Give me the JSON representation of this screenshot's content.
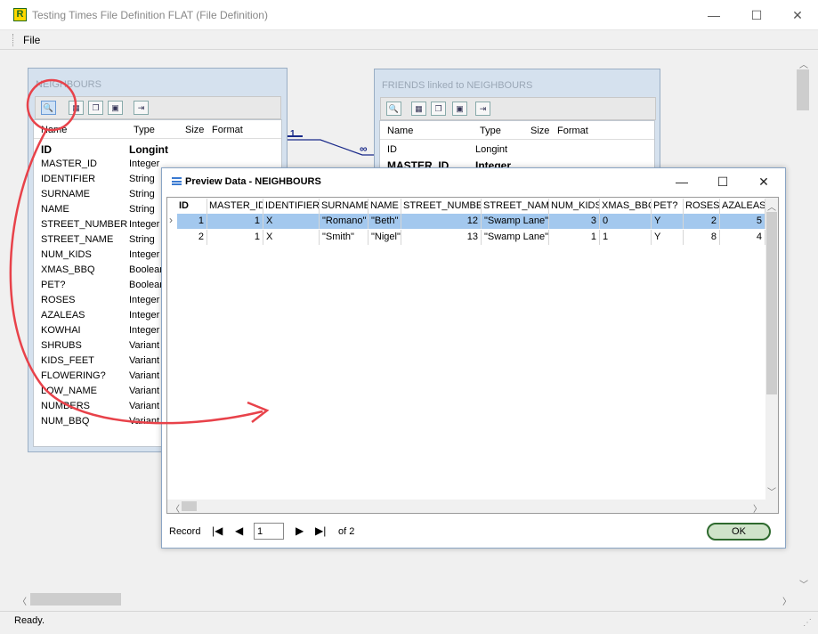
{
  "window": {
    "title": "Testing Times File Definition FLAT (File Definition)",
    "app_icon_letter": "R",
    "minimize_glyph": "—",
    "maximize_glyph": "☐",
    "close_glyph": "✕"
  },
  "menu": {
    "file": "File"
  },
  "status": "Ready.",
  "neighbours": {
    "title": "NEIGHBOURS",
    "columns": [
      "Name",
      "Type",
      "Size",
      "Format"
    ],
    "fields": [
      {
        "name": "ID",
        "type": "Longint",
        "bold": true
      },
      {
        "name": "MASTER_ID",
        "type": "Integer"
      },
      {
        "name": "IDENTIFIER",
        "type": "String"
      },
      {
        "name": "SURNAME",
        "type": "String"
      },
      {
        "name": "NAME",
        "type": "String"
      },
      {
        "name": "STREET_NUMBER",
        "type": "Integer"
      },
      {
        "name": "STREET_NAME",
        "type": "String"
      },
      {
        "name": "NUM_KIDS",
        "type": "Integer"
      },
      {
        "name": "XMAS_BBQ",
        "type": "Boolean"
      },
      {
        "name": "PET?",
        "type": "Boolean"
      },
      {
        "name": "ROSES",
        "type": "Integer"
      },
      {
        "name": "AZALEAS",
        "type": "Integer"
      },
      {
        "name": "KOWHAI",
        "type": "Integer"
      },
      {
        "name": "SHRUBS",
        "type": "Variant"
      },
      {
        "name": "KIDS_FEET",
        "type": "Variant"
      },
      {
        "name": "FLOWERING?",
        "type": "Variant"
      },
      {
        "name": "LOW_NAME",
        "type": "Variant"
      },
      {
        "name": "NUMBERS",
        "type": "Variant"
      },
      {
        "name": "NUM_BBQ",
        "type": "Variant"
      }
    ]
  },
  "friends": {
    "title": "FRIENDS linked to NEIGHBOURS",
    "columns": [
      "Name",
      "Type",
      "Size",
      "Format"
    ],
    "fields": [
      {
        "name": "ID",
        "type": "Longint"
      },
      {
        "name": "MASTER_ID",
        "type": "Integer",
        "bold": true
      }
    ]
  },
  "link": {
    "one": "1",
    "many": "∞"
  },
  "preview": {
    "title": "Preview Data - NEIGHBOURS",
    "columns": [
      "ID",
      "MASTER_ID",
      "IDENTIFIER",
      "SURNAME",
      "NAME",
      "STREET_NUMBER",
      "STREET_NAME",
      "NUM_KIDS",
      "XMAS_BBQ",
      "PET?",
      "ROSES",
      "AZALEAS"
    ],
    "rows": [
      [
        "1",
        "1",
        "X",
        "\"Romano\"",
        "\"Beth\"",
        "12",
        "\"Swamp Lane\"",
        "3",
        "0",
        "Y",
        "2",
        "5"
      ],
      [
        "2",
        "1",
        "X",
        "\"Smith\"",
        "\"Nigel\"",
        "13",
        "\"Swamp Lane\"",
        "1",
        "1",
        "Y",
        "8",
        "4"
      ]
    ],
    "record_label": "Record",
    "record_value": "1",
    "record_of": "of 2",
    "ok_label": "OK",
    "selected_row": 1
  },
  "colors": {
    "panel_bg": "#d5e1ee",
    "selected_row": "#a3c8ee",
    "annotation": "#e8424a",
    "ok_border": "#2e6a2e"
  }
}
